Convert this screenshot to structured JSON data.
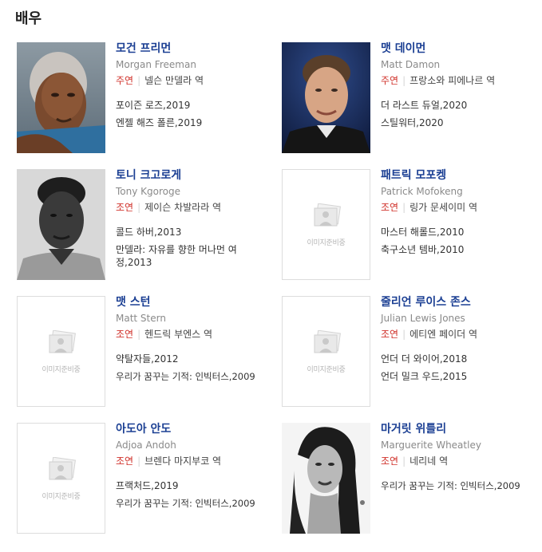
{
  "section": {
    "title": "배우"
  },
  "placeholder": {
    "text": "이미지준비중"
  },
  "actors": [
    {
      "name": "모건 프리먼",
      "english_name": "Morgan Freeman",
      "role_type": "주연",
      "character": "넬슨 만델라 역",
      "films": [
        "포이즌 로즈,2019",
        "엔젤 해즈 폴른,2019"
      ]
    },
    {
      "name": "맷 데이먼",
      "english_name": "Matt Damon",
      "role_type": "주연",
      "character": "프랑소와 피에나르 역",
      "films": [
        "더 라스트 듀얼,2020",
        "스틸워터,2020"
      ]
    },
    {
      "name": "토니 크고로게",
      "english_name": "Tony Kgoroge",
      "role_type": "조연",
      "character": "제이슨 차발라라 역",
      "films": [
        "콜드 하버,2013",
        "만델라: 자유를 향한 머나먼 여정,2013"
      ]
    },
    {
      "name": "패트릭 모포켕",
      "english_name": "Patrick Mofokeng",
      "role_type": "조연",
      "character": "링가 문세이미 역",
      "films": [
        "마스터 해롤드,2010",
        "축구소년 템바,2010"
      ]
    },
    {
      "name": "맷 스턴",
      "english_name": "Matt Stern",
      "role_type": "조연",
      "character": "헨드릭 부엔스 역",
      "films": [
        "약탈자들,2012",
        "우리가 꿈꾸는 기적: 인빅터스,2009"
      ]
    },
    {
      "name": "줄리언 루이스 존스",
      "english_name": "Julian Lewis Jones",
      "role_type": "조연",
      "character": "에티엔 페이더 역",
      "films": [
        "언더 더 와이어,2018",
        "언더 밀크 우드,2015"
      ]
    },
    {
      "name": "아도아 안도",
      "english_name": "Adjoa Andoh",
      "role_type": "조연",
      "character": "브렌다 마지부코 역",
      "films": [
        "프랙처드,2019",
        "우리가 꿈꾸는 기적: 인빅터스,2009"
      ]
    },
    {
      "name": "마거릿 위틀리",
      "english_name": "Marguerite Wheatley",
      "role_type": "조연",
      "character": "네리네 역",
      "films": [
        "우리가 꿈꾸는 기적: 인빅터스,2009"
      ]
    }
  ]
}
